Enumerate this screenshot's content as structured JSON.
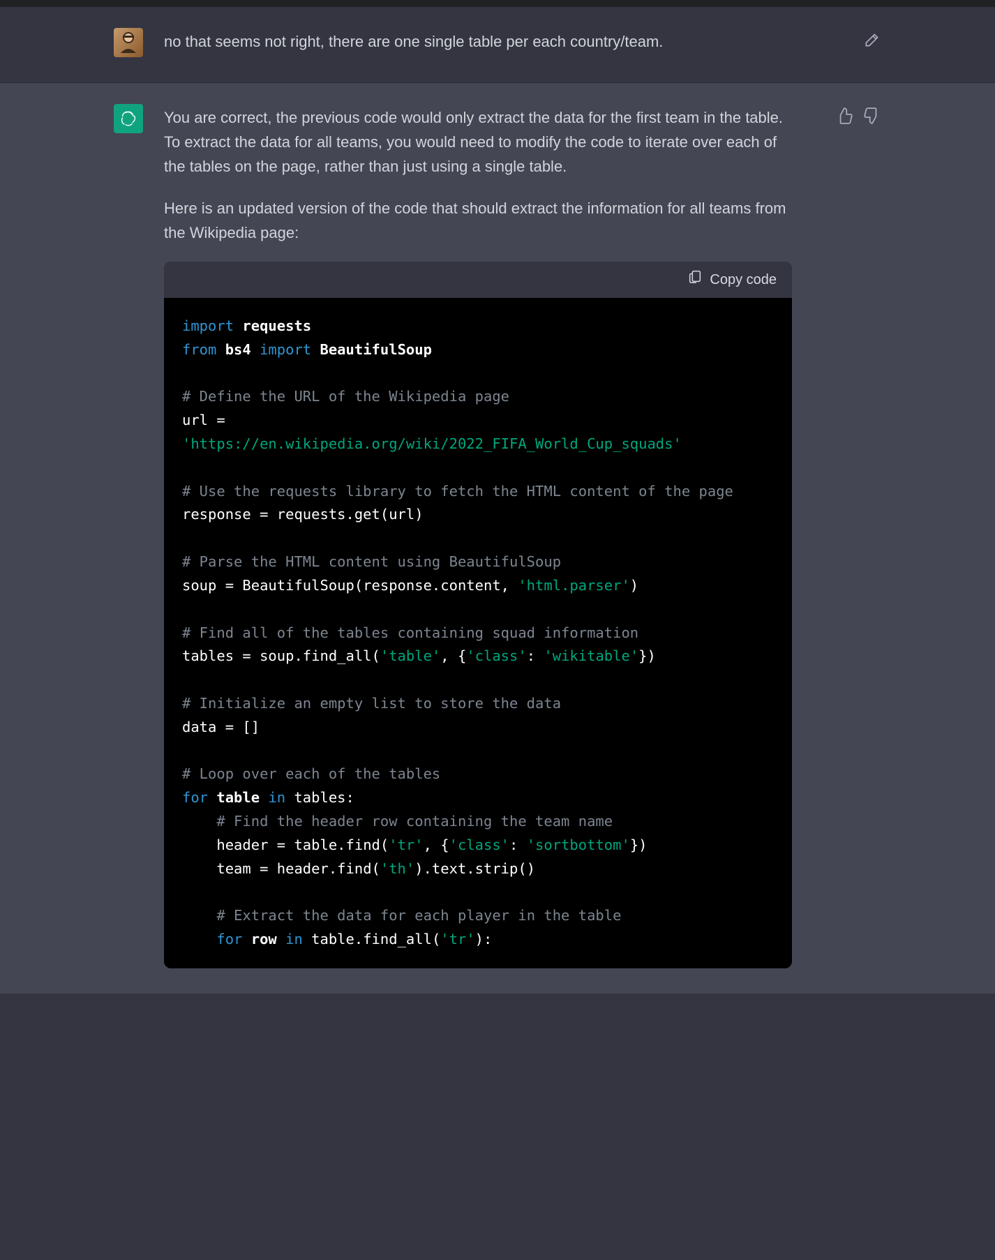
{
  "user_message": {
    "text": "no that seems not right, there are one single table per each country/team."
  },
  "assistant_message": {
    "paragraphs": [
      "You are correct, the previous code would only extract the data for the first team in the table. To extract the data for all teams, you would need to modify the code to iterate over each of the tables on the page, rather than just using a single table.",
      "Here is an updated version of the code that should extract the information for all teams from the Wikipedia page:"
    ]
  },
  "codeblock": {
    "copy_label": "Copy code",
    "tokens": [
      {
        "t": "kw",
        "v": "import"
      },
      {
        "t": "sp",
        "v": " "
      },
      {
        "t": "mod",
        "v": "requests"
      },
      {
        "t": "nl"
      },
      {
        "t": "kw",
        "v": "from"
      },
      {
        "t": "sp",
        "v": " "
      },
      {
        "t": "mod",
        "v": "bs4"
      },
      {
        "t": "sp",
        "v": " "
      },
      {
        "t": "kw",
        "v": "import"
      },
      {
        "t": "sp",
        "v": " "
      },
      {
        "t": "mod",
        "v": "BeautifulSoup"
      },
      {
        "t": "nl"
      },
      {
        "t": "nl"
      },
      {
        "t": "cm",
        "v": "# Define the URL of the Wikipedia page"
      },
      {
        "t": "nl"
      },
      {
        "t": "var",
        "v": "url = "
      },
      {
        "t": "nl"
      },
      {
        "t": "str",
        "v": "'https://en.wikipedia.org/wiki/2022_FIFA_World_Cup_squads'"
      },
      {
        "t": "nl"
      },
      {
        "t": "nl"
      },
      {
        "t": "cm",
        "v": "# Use the requests library to fetch the HTML content of the page"
      },
      {
        "t": "nl"
      },
      {
        "t": "var",
        "v": "response = requests.get(url)"
      },
      {
        "t": "nl"
      },
      {
        "t": "nl"
      },
      {
        "t": "cm",
        "v": "# Parse the HTML content using BeautifulSoup"
      },
      {
        "t": "nl"
      },
      {
        "t": "var",
        "v": "soup = BeautifulSoup(response.content, "
      },
      {
        "t": "str",
        "v": "'html.parser'"
      },
      {
        "t": "var",
        "v": ")"
      },
      {
        "t": "nl"
      },
      {
        "t": "nl"
      },
      {
        "t": "cm",
        "v": "# Find all of the tables containing squad information"
      },
      {
        "t": "nl"
      },
      {
        "t": "var",
        "v": "tables = soup.find_all("
      },
      {
        "t": "str",
        "v": "'table'"
      },
      {
        "t": "var",
        "v": ", {"
      },
      {
        "t": "str",
        "v": "'class'"
      },
      {
        "t": "var",
        "v": ": "
      },
      {
        "t": "str",
        "v": "'wikitable'"
      },
      {
        "t": "var",
        "v": "})"
      },
      {
        "t": "nl"
      },
      {
        "t": "nl"
      },
      {
        "t": "cm",
        "v": "# Initialize an empty list to store the data"
      },
      {
        "t": "nl"
      },
      {
        "t": "var",
        "v": "data = []"
      },
      {
        "t": "nl"
      },
      {
        "t": "nl"
      },
      {
        "t": "cm",
        "v": "# Loop over each of the tables"
      },
      {
        "t": "nl"
      },
      {
        "t": "kw",
        "v": "for"
      },
      {
        "t": "sp",
        "v": " "
      },
      {
        "t": "mod",
        "v": "table"
      },
      {
        "t": "sp",
        "v": " "
      },
      {
        "t": "kw",
        "v": "in"
      },
      {
        "t": "sp",
        "v": " "
      },
      {
        "t": "var",
        "v": "tables:"
      },
      {
        "t": "nl"
      },
      {
        "t": "sp",
        "v": "    "
      },
      {
        "t": "cm",
        "v": "# Find the header row containing the team name"
      },
      {
        "t": "nl"
      },
      {
        "t": "sp",
        "v": "    "
      },
      {
        "t": "var",
        "v": "header = table.find("
      },
      {
        "t": "str",
        "v": "'tr'"
      },
      {
        "t": "var",
        "v": ", {"
      },
      {
        "t": "str",
        "v": "'class'"
      },
      {
        "t": "var",
        "v": ": "
      },
      {
        "t": "str",
        "v": "'sortbottom'"
      },
      {
        "t": "var",
        "v": "})"
      },
      {
        "t": "nl"
      },
      {
        "t": "sp",
        "v": "    "
      },
      {
        "t": "var",
        "v": "team = header.find("
      },
      {
        "t": "str",
        "v": "'th'"
      },
      {
        "t": "var",
        "v": ").text.strip()"
      },
      {
        "t": "nl"
      },
      {
        "t": "nl"
      },
      {
        "t": "sp",
        "v": "    "
      },
      {
        "t": "cm",
        "v": "# Extract the data for each player in the table"
      },
      {
        "t": "nl"
      },
      {
        "t": "sp",
        "v": "    "
      },
      {
        "t": "kw",
        "v": "for"
      },
      {
        "t": "sp",
        "v": " "
      },
      {
        "t": "mod",
        "v": "row"
      },
      {
        "t": "sp",
        "v": " "
      },
      {
        "t": "kw",
        "v": "in"
      },
      {
        "t": "sp",
        "v": " "
      },
      {
        "t": "var",
        "v": "table.find_all("
      },
      {
        "t": "str",
        "v": "'tr'"
      },
      {
        "t": "var",
        "v": "):"
      },
      {
        "t": "nl"
      }
    ]
  },
  "icons": {
    "edit": "edit-icon",
    "thumbs_up": "thumbs-up-icon",
    "thumbs_down": "thumbs-down-icon",
    "clipboard": "clipboard-icon"
  }
}
